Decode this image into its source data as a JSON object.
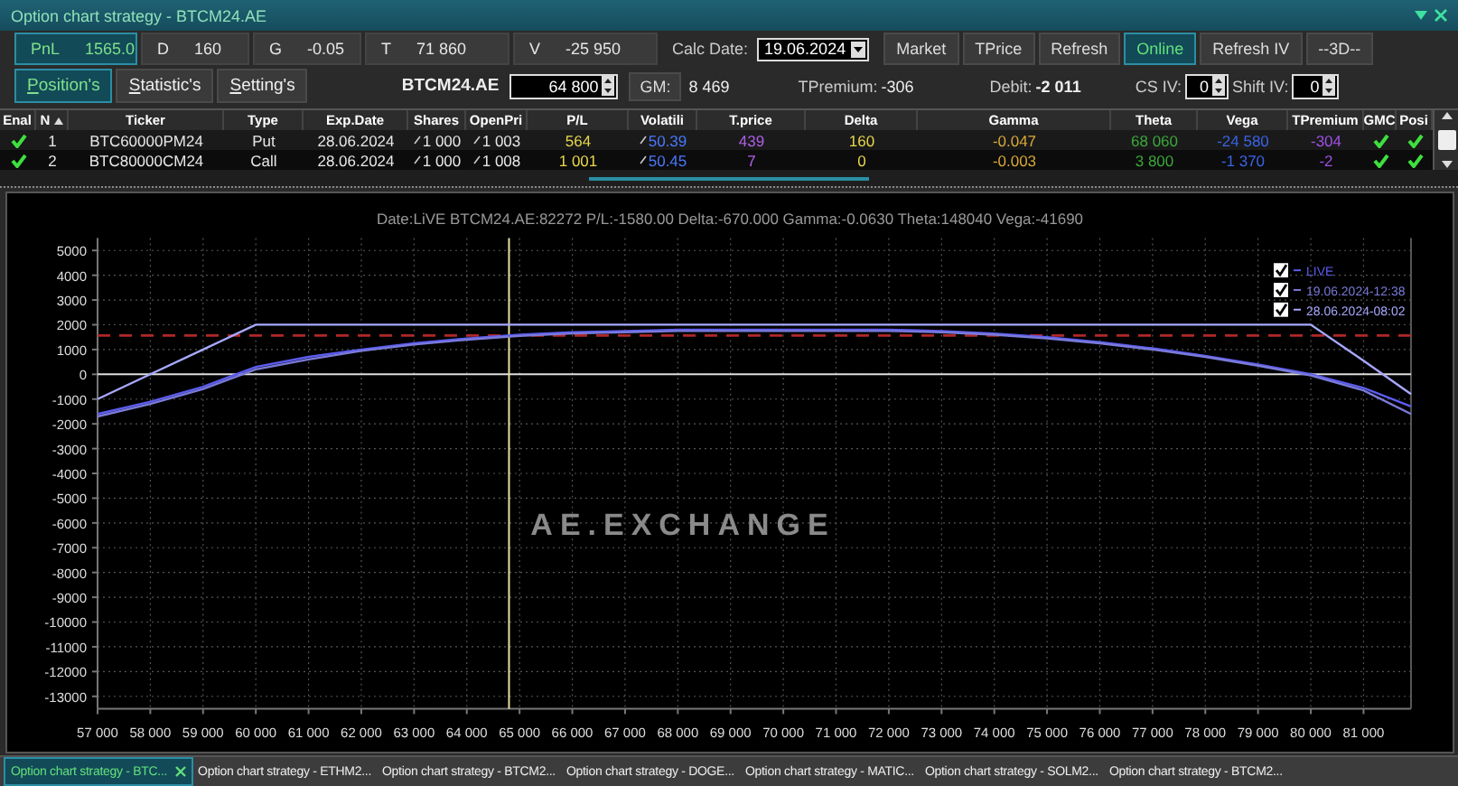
{
  "window": {
    "title": "Option chart strategy - BTCM24.AE"
  },
  "stats": [
    {
      "label": "PnL",
      "value": "1565.0",
      "selected": true
    },
    {
      "label": "D",
      "value": "160",
      "selected": false
    },
    {
      "label": "G",
      "value": "-0.05",
      "selected": false
    },
    {
      "label": "T",
      "value": "71 860",
      "selected": false
    },
    {
      "label": "V",
      "value": "-25 950",
      "selected": false
    }
  ],
  "calc_date": {
    "label": "Calc Date:",
    "value": "19.06.2024"
  },
  "actions": [
    {
      "label": "Market",
      "selected": false
    },
    {
      "label": "TPrice",
      "selected": false
    },
    {
      "label": "Refresh",
      "selected": false
    },
    {
      "label": "Online",
      "selected": true
    },
    {
      "label": "Refresh IV",
      "selected": false
    },
    {
      "label": "--3D--",
      "selected": false
    }
  ],
  "tabs": [
    {
      "label": "Position's",
      "selected": true
    },
    {
      "label": "Statistic's",
      "selected": false
    },
    {
      "label": "Setting's",
      "selected": false
    }
  ],
  "instrument": {
    "symbol": "BTCM24.AE",
    "price": "64 800",
    "gm_button": "GM:",
    "gm_value": "8 469"
  },
  "tpremium": {
    "label": "TPremium:",
    "value": "-306"
  },
  "debit": {
    "label": "Debit:",
    "value": "-2 011"
  },
  "cs_iv": {
    "label": "CS IV:",
    "value": "0"
  },
  "shift_iv": {
    "label": "Shift IV:",
    "value": "0"
  },
  "table": {
    "columns": [
      {
        "label": "Enal",
        "sorted": false
      },
      {
        "label": "N",
        "sorted": true
      },
      {
        "label": "Ticker",
        "sorted": false
      },
      {
        "label": "Type",
        "sorted": false
      },
      {
        "label": "Exp.Date",
        "sorted": false
      },
      {
        "label": "Shares",
        "sorted": false
      },
      {
        "label": "OpenPri",
        "sorted": false
      },
      {
        "label": "P/L",
        "sorted": false
      },
      {
        "label": "Volatili",
        "sorted": false
      },
      {
        "label": "T.price",
        "sorted": false
      },
      {
        "label": "Delta",
        "sorted": false
      },
      {
        "label": "Gamma",
        "sorted": false
      },
      {
        "label": "Theta",
        "sorted": false
      },
      {
        "label": "Vega",
        "sorted": false
      },
      {
        "label": "TPremium",
        "sorted": false
      },
      {
        "label": "GMC",
        "sorted": false
      },
      {
        "label": "Posi",
        "sorted": false
      }
    ],
    "rows": [
      {
        "enabled": true,
        "cells": [
          "",
          "1",
          "BTC60000PM24",
          "Put",
          "28.06.2024",
          "1 000",
          "1 003",
          "564",
          "50.39",
          "439",
          "160",
          "-0.047",
          "68 060",
          "-24 580",
          "-304",
          "",
          ""
        ],
        "gmc": true,
        "pos": true
      },
      {
        "enabled": true,
        "cells": [
          "",
          "2",
          "BTC80000CM24",
          "Call",
          "28.06.2024",
          "1 000",
          "1 008",
          "1 001",
          "50.45",
          "7",
          "0",
          "-0.003",
          "3 800",
          "-1 370",
          "-2",
          "",
          ""
        ],
        "gmc": true,
        "pos": true
      }
    ]
  },
  "chart": {
    "watermark": "AE.EXCHANGE",
    "legend_checks": [
      {
        "checked": true
      },
      {
        "checked": true
      },
      {
        "checked": true
      }
    ],
    "chart_data": {
      "type": "line",
      "title": "Date:LiVE  BTCM24.AE:82272  P/L:-1580.00  Delta:-670.000  Gamma:-0.0630  Theta:148040  Vega:-41690",
      "x": [
        57000,
        58000,
        59000,
        60000,
        61000,
        62000,
        63000,
        64000,
        65000,
        66000,
        67000,
        68000,
        69000,
        70000,
        71000,
        72000,
        73000,
        74000,
        75000,
        76000,
        77000,
        78000,
        79000,
        80000,
        81000,
        81900
      ],
      "series": [
        {
          "name": "LIVE",
          "color": "#5c5cf0",
          "values": [
            -1600,
            -1100,
            -500,
            300,
            700,
            1000,
            1250,
            1450,
            1600,
            1700,
            1750,
            1800,
            1800,
            1800,
            1800,
            1800,
            1750,
            1650,
            1500,
            1300,
            1050,
            750,
            400,
            0,
            -550,
            -1300
          ]
        },
        {
          "name": "19.06.2024-12:38",
          "color": "#7a7ad8",
          "values": [
            -1700,
            -1200,
            -600,
            200,
            600,
            950,
            1200,
            1400,
            1550,
            1650,
            1700,
            1750,
            1750,
            1750,
            1750,
            1750,
            1700,
            1600,
            1450,
            1250,
            1000,
            700,
            350,
            -50,
            -650,
            -1600
          ]
        },
        {
          "name": "28.06.2024-08:02",
          "color": "#a8a8ff",
          "values": [
            -1000,
            0,
            1000,
            2000,
            2000,
            2000,
            2000,
            2000,
            2000,
            2000,
            2000,
            2000,
            2000,
            2000,
            2000,
            2000,
            2000,
            2000,
            2000,
            2000,
            2000,
            2000,
            2000,
            2000,
            550,
            -800
          ]
        }
      ],
      "xlim": [
        57000,
        81900
      ],
      "ylim": [
        -13500,
        5500
      ],
      "xticks": [
        {
          "value": 57000,
          "label": "57 000"
        },
        {
          "value": 58000,
          "label": "58 000"
        },
        {
          "value": 59000,
          "label": "59 000"
        },
        {
          "value": 60000,
          "label": "60 000"
        },
        {
          "value": 61000,
          "label": "61 000"
        },
        {
          "value": 62000,
          "label": "62 000"
        },
        {
          "value": 63000,
          "label": "63 000"
        },
        {
          "value": 64000,
          "label": "64 000"
        },
        {
          "value": 65000,
          "label": "65 000"
        },
        {
          "value": 66000,
          "label": "66 000"
        },
        {
          "value": 67000,
          "label": "67 000"
        },
        {
          "value": 68000,
          "label": "68 000"
        },
        {
          "value": 69000,
          "label": "69 000"
        },
        {
          "value": 70000,
          "label": "70 000"
        },
        {
          "value": 71000,
          "label": "71 000"
        },
        {
          "value": 72000,
          "label": "72 000"
        },
        {
          "value": 73000,
          "label": "73 000"
        },
        {
          "value": 74000,
          "label": "74 000"
        },
        {
          "value": 75000,
          "label": "75 000"
        },
        {
          "value": 76000,
          "label": "76 000"
        },
        {
          "value": 77000,
          "label": "77 000"
        },
        {
          "value": 78000,
          "label": "78 000"
        },
        {
          "value": 79000,
          "label": "79 000"
        },
        {
          "value": 80000,
          "label": "80 000"
        },
        {
          "value": 81000,
          "label": "81 000"
        }
      ],
      "yticks": [
        5000,
        4000,
        3000,
        2000,
        1000,
        0,
        -1000,
        -2000,
        -3000,
        -4000,
        -5000,
        -6000,
        -7000,
        -8000,
        -9000,
        -10000,
        -11000,
        -12000,
        -13000
      ],
      "grid": true,
      "legend": true,
      "ref_lines": [
        {
          "axis": "y",
          "value": 1565
        },
        {
          "axis": "x",
          "value": 64800
        }
      ]
    }
  },
  "doc_tabs": [
    {
      "label": "Option chart strategy - BTC...",
      "selected": true
    },
    {
      "label": "Option chart strategy - ETHM2...",
      "selected": false
    },
    {
      "label": "Option chart strategy - BTCM2...",
      "selected": false
    },
    {
      "label": "Option chart strategy - DOGE...",
      "selected": false
    },
    {
      "label": "Option chart strategy - MATIC...",
      "selected": false
    },
    {
      "label": "Option chart strategy - SOLM2...",
      "selected": false
    },
    {
      "label": "Option chart strategy - BTCM2...",
      "selected": false
    }
  ]
}
